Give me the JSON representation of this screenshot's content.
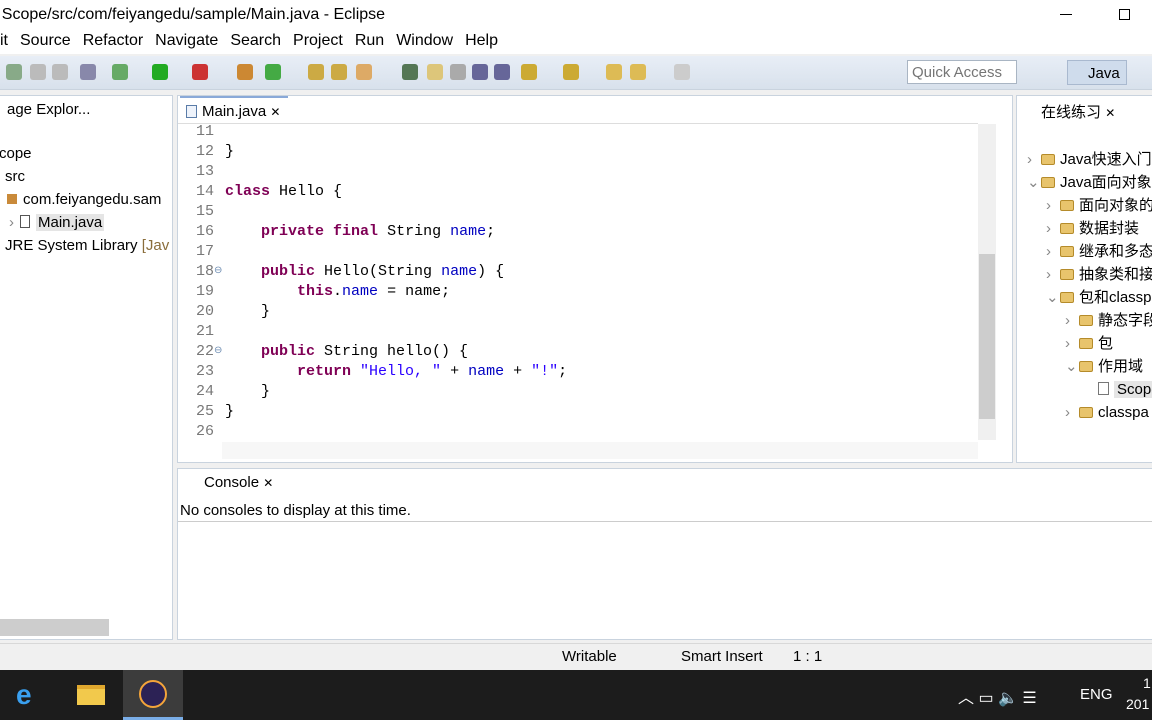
{
  "window": {
    "title": "- Scope/src/com/feiyangedu/sample/Main.java - Eclipse",
    "restore_icon": "restore-icon"
  },
  "menu": [
    "it",
    "Source",
    "Refactor",
    "Navigate",
    "Search",
    "Project",
    "Run",
    "Window",
    "Help"
  ],
  "toolbar": {
    "quick_access": "Quick Access",
    "perspective": "Java"
  },
  "explorer": {
    "tab": "age Explor...",
    "items": [
      {
        "label": "cope"
      },
      {
        "label": "src"
      },
      {
        "label": "com.feiyangedu.sam"
      },
      {
        "label": "Main.java"
      },
      {
        "label": "JRE System Library",
        "suffix": "[Jav"
      }
    ]
  },
  "editor": {
    "tab": "Main.java",
    "lines": [
      {
        "n": "11",
        "t": []
      },
      {
        "n": "12",
        "t": [
          [
            "",
            "}"
          ]
        ]
      },
      {
        "n": "13",
        "t": []
      },
      {
        "n": "14",
        "t": [
          [
            "kw",
            "class"
          ],
          [
            "",
            " Hello {"
          ]
        ]
      },
      {
        "n": "15",
        "t": []
      },
      {
        "n": "16",
        "t": [
          [
            "",
            "    "
          ],
          [
            "kw",
            "private"
          ],
          [
            "",
            " "
          ],
          [
            "kw",
            "final"
          ],
          [
            "",
            " String "
          ],
          [
            "fd",
            "name"
          ],
          [
            "",
            ";"
          ]
        ]
      },
      {
        "n": "17",
        "t": []
      },
      {
        "n": "18",
        "t": [
          [
            "",
            "    "
          ],
          [
            "kw",
            "public"
          ],
          [
            "",
            " Hello(String "
          ],
          [
            "fd",
            "name"
          ],
          [
            "",
            ") {"
          ]
        ]
      },
      {
        "n": "19",
        "t": [
          [
            "",
            "        "
          ],
          [
            "kw",
            "this"
          ],
          [
            "",
            "."
          ],
          [
            "fd",
            "name"
          ],
          [
            "",
            " = name;"
          ]
        ]
      },
      {
        "n": "20",
        "t": [
          [
            "",
            "    }"
          ]
        ]
      },
      {
        "n": "21",
        "t": []
      },
      {
        "n": "22",
        "t": [
          [
            "",
            "    "
          ],
          [
            "kw",
            "public"
          ],
          [
            "",
            " String hello() {"
          ]
        ]
      },
      {
        "n": "23",
        "t": [
          [
            "",
            "        "
          ],
          [
            "kw",
            "return"
          ],
          [
            "",
            " "
          ],
          [
            "st",
            "\"Hello, \""
          ],
          [
            "",
            " + "
          ],
          [
            "fd",
            "name"
          ],
          [
            "",
            " + "
          ],
          [
            "st",
            "\"!\""
          ],
          [
            "",
            ";"
          ]
        ]
      },
      {
        "n": "24",
        "t": [
          [
            "",
            "    }"
          ]
        ]
      },
      {
        "n": "25",
        "t": [
          [
            "",
            "}"
          ]
        ]
      },
      {
        "n": "26",
        "t": []
      }
    ]
  },
  "console": {
    "tab": "Console",
    "message": "No consoles to display at this time."
  },
  "practice": {
    "tab": "在线练习",
    "items": [
      {
        "label": "Java快速入门",
        "depth": 0,
        "exp": ">"
      },
      {
        "label": "Java面向对象",
        "depth": 0,
        "exp": "v"
      },
      {
        "label": "面向对象的",
        "depth": 1,
        "exp": ">"
      },
      {
        "label": "数据封装",
        "depth": 1,
        "exp": ">"
      },
      {
        "label": "继承和多态",
        "depth": 1,
        "exp": ">"
      },
      {
        "label": "抽象类和接",
        "depth": 1,
        "exp": ">"
      },
      {
        "label": "包和classp",
        "depth": 1,
        "exp": "v"
      },
      {
        "label": "静态字段",
        "depth": 2,
        "exp": ">"
      },
      {
        "label": "包",
        "depth": 2,
        "exp": ">"
      },
      {
        "label": "作用域",
        "depth": 2,
        "exp": "v"
      },
      {
        "label": "Scope",
        "depth": 3,
        "exp": ""
      },
      {
        "label": "classpa",
        "depth": 2,
        "exp": ">"
      }
    ]
  },
  "status": {
    "writable": "Writable",
    "insert": "Smart Insert",
    "position": "1 : 1"
  },
  "taskbar": {
    "lang": "ENG",
    "clock1": "1",
    "clock2": "201"
  }
}
